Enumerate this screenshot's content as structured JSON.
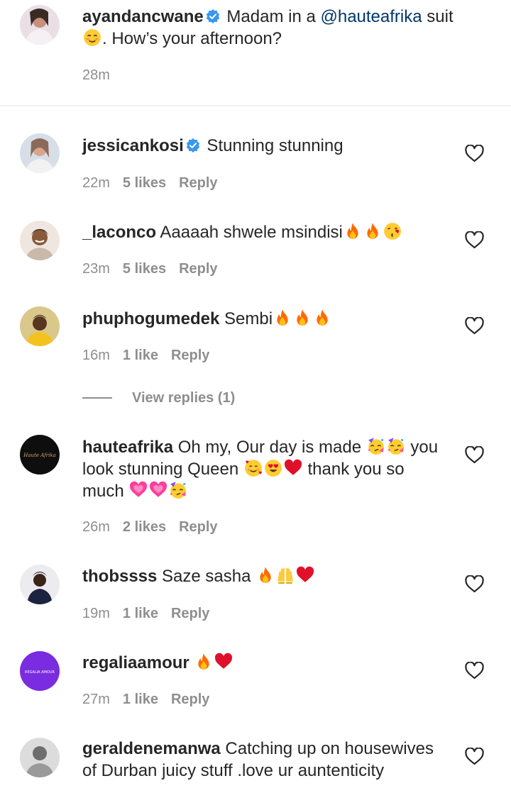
{
  "caption": {
    "username": "ayandancwane",
    "text_before_mention": " Madam in a ",
    "mention": "@hauteafrika",
    "text_after_mention": " suit",
    "text_line2": ". How’s your afternoon?",
    "time": "28m"
  },
  "comments": [
    {
      "username": "jessicankosi",
      "text": " Stunning stunning",
      "time": "22m",
      "likes": "5 likes",
      "reply": "Reply"
    },
    {
      "username": "_laconco",
      "text": " Aaaaah shwele msindisi",
      "time": "23m",
      "likes": "5 likes",
      "reply": "Reply"
    },
    {
      "username": "phuphogumedek",
      "text": " Sembi",
      "time": "16m",
      "likes": "1 like",
      "reply": "Reply",
      "view_replies": "View replies (1)"
    },
    {
      "username": "hauteafrika",
      "text_a": " Oh my, Our day is made ",
      "text_b": " you",
      "text_c": "look stunning Queen ",
      "text_d": " thank you so",
      "text_e": "much ",
      "time": "26m",
      "likes": "2 likes",
      "reply": "Reply"
    },
    {
      "username": "thobssss",
      "text": " Saze sasha ",
      "time": "19m",
      "likes": "1 like",
      "reply": "Reply"
    },
    {
      "username": "regaliaamour",
      "text": " ",
      "time": "27m",
      "likes": "1 like",
      "reply": "Reply"
    },
    {
      "username": "geraldenemanwa",
      "text_a": " Catching up on housewives",
      "text_b": "of Durban juicy stuff .love ur auntenticity"
    }
  ],
  "icons": {
    "verified": "verified-badge-icon",
    "heart": "heart-outline-icon",
    "fire": "fire-emoji",
    "kiss": "kissing-face-emoji",
    "party": "partying-face-emoji",
    "hearts": "smiling-face-with-hearts-emoji",
    "heart_eyes": "heart-eyes-emoji",
    "red_heart": "red-heart-emoji",
    "pink_heart": "growing-heart-emoji",
    "raised_hands": "raised-hands-emoji",
    "blush": "smiling-face-emoji"
  },
  "avatars": {
    "hauteafrika_logo": "Haute Afrika",
    "regaliaamour_logo": "REGALIA AMOUR"
  },
  "colors": {
    "text": "#262626",
    "meta": "#8e8e8e",
    "mention": "#00376b",
    "verified": "#3897f0"
  }
}
